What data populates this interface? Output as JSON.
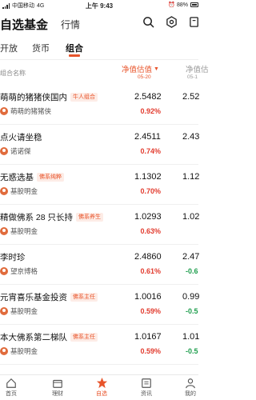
{
  "status": {
    "carrier": "中国移动",
    "network": "4G",
    "time": "上午 9:43",
    "battery": "88%"
  },
  "header": {
    "title": "自选基金",
    "tab_market": "行情"
  },
  "subtabs": [
    "开放",
    "货币",
    "组合"
  ],
  "active_subtab": "组合",
  "columns": {
    "left": "组合名称",
    "nav_label": "净值估值",
    "nav_date": "05-20",
    "nav2_label": "净值估",
    "nav2_date": "05-1"
  },
  "rows": [
    {
      "name": "萌萌的猪猪侠国内",
      "tag": "牛人组合",
      "owner": "萌萌的猪猪侠",
      "nav": "2.5482",
      "pct": "0.92%",
      "nav2": "2.52",
      "pct2": "",
      "dir": "up"
    },
    {
      "name": "点火请坐稳",
      "tag": "",
      "owner": "诺诺傑",
      "nav": "2.4511",
      "pct": "0.74%",
      "nav2": "2.43",
      "pct2": "",
      "dir": "up"
    },
    {
      "name": "无惑选基",
      "tag": "佛系纯粹",
      "owner": "基股明金",
      "nav": "1.1302",
      "pct": "0.70%",
      "nav2": "1.12",
      "pct2": "",
      "dir": "up"
    },
    {
      "name": "精做佛系 28 只长持",
      "tag": "佛系养生",
      "owner": "基股明金",
      "nav": "1.0293",
      "pct": "0.63%",
      "nav2": "1.02",
      "pct2": "",
      "dir": "up"
    },
    {
      "name": "李时珍",
      "tag": "",
      "owner": "望京博格",
      "nav": "2.4860",
      "pct": "0.61%",
      "nav2": "2.47",
      "pct2": "-0.6",
      "dir": "up"
    },
    {
      "name": "元宵喜乐基金投资",
      "tag": "佛系主任",
      "owner": "基股明金",
      "nav": "1.0016",
      "pct": "0.59%",
      "nav2": "0.99",
      "pct2": "-0.5",
      "dir": "up"
    },
    {
      "name": "本大佛系第二梯队",
      "tag": "佛系主任",
      "owner": "基股明金",
      "nav": "1.0167",
      "pct": "0.59%",
      "nav2": "1.01",
      "pct2": "-0.5",
      "dir": "up"
    }
  ],
  "tabbar": {
    "home": "首页",
    "wealth": "理财",
    "watchlist": "自选",
    "news": "资讯",
    "mine": "我的"
  },
  "colors": {
    "accent": "#e8542b",
    "up": "#e23b2e",
    "down": "#1e9e4d"
  }
}
